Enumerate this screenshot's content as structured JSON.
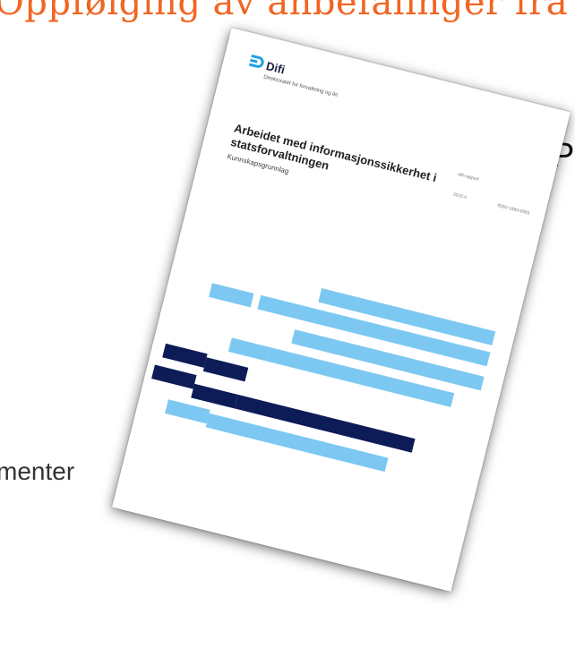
{
  "slide": {
    "title": "Oppfølging av anbefalinger fra",
    "bullet_text": "P",
    "side_text": "menter"
  },
  "cover": {
    "logo_name": "Difi",
    "logo_tagline": "Direktoratet for forvaltning og ikt",
    "title": "Arbeidet med informasjonssikkerhet i statsforvaltningen",
    "subtitle": "Kunnskapsgrunnlag",
    "meta": [
      "difi-rapport",
      "2015:4",
      "ISSN 1890-6583"
    ]
  },
  "colors": {
    "accent": "#f26522",
    "logo_blue": "#1ea0e6",
    "bar_light": "#7cc8f2",
    "bar_dark": "#0d1b57"
  },
  "icons": {
    "logo": "difi-logo-icon",
    "bullet": "bullet-dot"
  }
}
